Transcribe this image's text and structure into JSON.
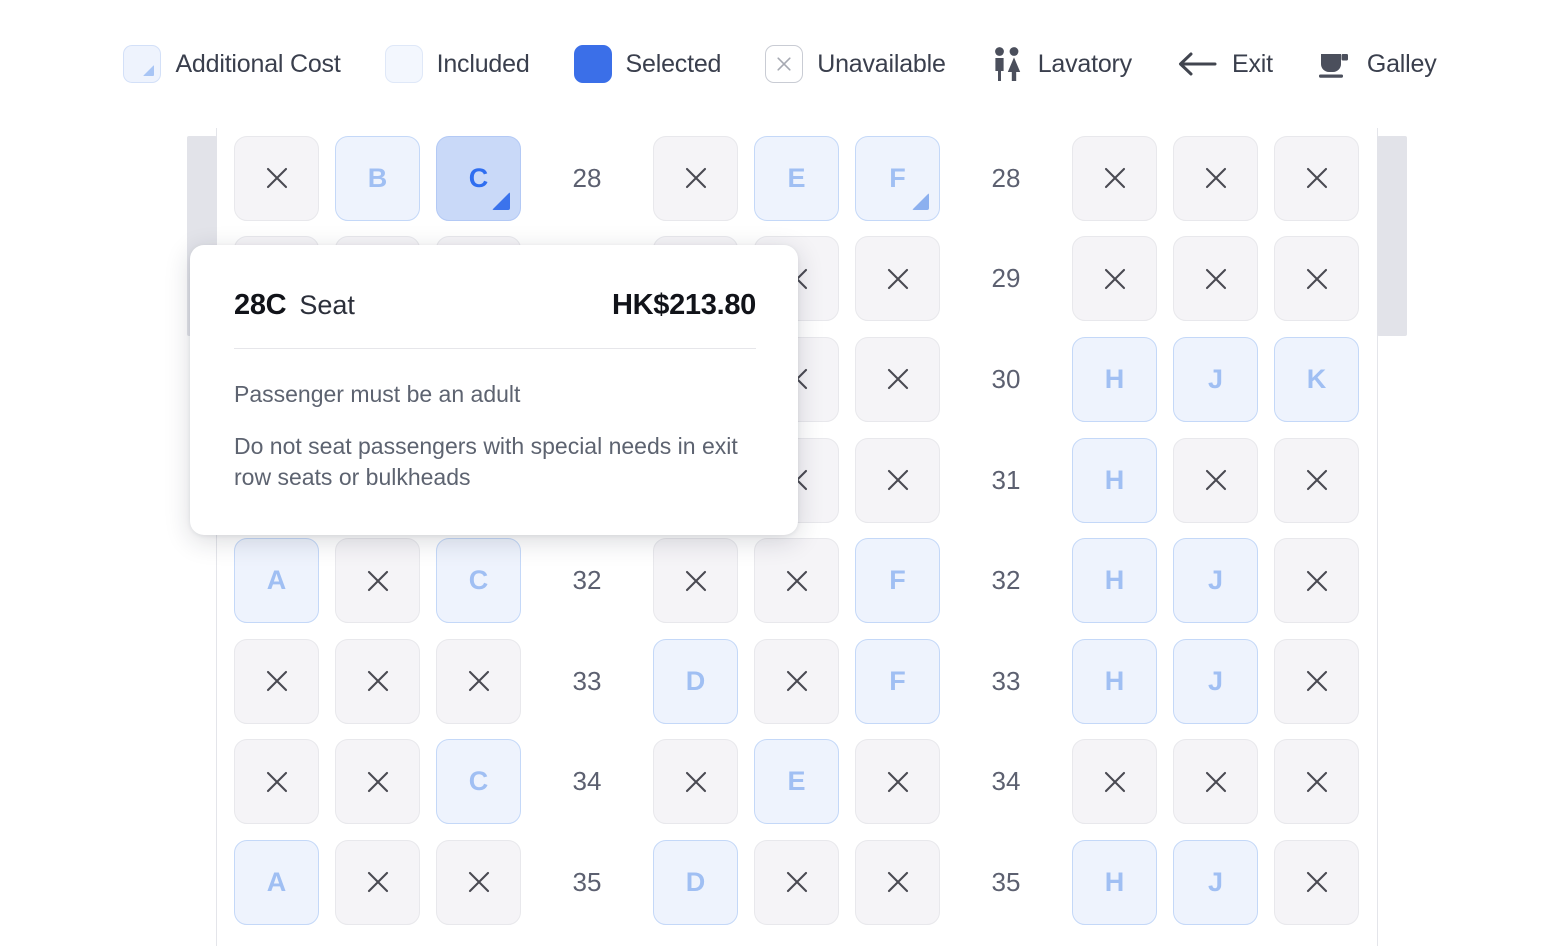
{
  "legend": {
    "items": [
      {
        "label": "Additional Cost",
        "icon": "additional-cost-swatch-icon"
      },
      {
        "label": "Included",
        "icon": "included-swatch-icon"
      },
      {
        "label": "Selected",
        "icon": "selected-swatch-icon"
      },
      {
        "label": "Unavailable",
        "icon": "unavailable-swatch-icon"
      },
      {
        "label": "Lavatory",
        "icon": "lavatory-icon"
      },
      {
        "label": "Exit",
        "icon": "exit-arrow-icon"
      },
      {
        "label": "Galley",
        "icon": "galley-cup-icon"
      }
    ]
  },
  "colors": {
    "selected": "#3b6fe8",
    "included_bg": "#eef3fd",
    "included_text": "#a0bff3",
    "unavailable_bg": "#f5f4f7",
    "hovered_bg": "#c9d9f8",
    "hovered_text": "#2f6ef0",
    "wall": "#e2e3e9",
    "text": "#3a3f4d"
  },
  "tooltip": {
    "seat_number": "28C",
    "seat_word": "Seat",
    "price": "HK$213.80",
    "notes": [
      "Passenger must be an adult",
      "Do not seat passengers with special needs in exit row seats or bulkheads"
    ]
  },
  "seatmap": {
    "unavailable_glyph": "×",
    "rows": [
      {
        "number": "28",
        "left": [
          {
            "label": "×",
            "state": "unavailable"
          },
          {
            "label": "B",
            "state": "included"
          },
          {
            "label": "C",
            "state": "hovered",
            "addcost": true
          }
        ],
        "middle": [
          {
            "label": "×",
            "state": "unavailable"
          },
          {
            "label": "E",
            "state": "included"
          },
          {
            "label": "F",
            "state": "addcost",
            "addcost": true
          }
        ],
        "right": [
          {
            "label": "×",
            "state": "unavailable"
          },
          {
            "label": "×",
            "state": "unavailable"
          },
          {
            "label": "×",
            "state": "unavailable"
          }
        ]
      },
      {
        "number": "29",
        "left": [
          {
            "label": "×",
            "state": "unavailable"
          },
          {
            "label": "×",
            "state": "unavailable"
          },
          {
            "label": "×",
            "state": "unavailable"
          }
        ],
        "middle": [
          {
            "label": "×",
            "state": "unavailable"
          },
          {
            "label": "×",
            "state": "unavailable"
          },
          {
            "label": "×",
            "state": "unavailable"
          }
        ],
        "right": [
          {
            "label": "×",
            "state": "unavailable"
          },
          {
            "label": "×",
            "state": "unavailable"
          },
          {
            "label": "×",
            "state": "unavailable"
          }
        ]
      },
      {
        "number": "30",
        "left": [
          {
            "label": "×",
            "state": "unavailable"
          },
          {
            "label": "×",
            "state": "unavailable"
          },
          {
            "label": "×",
            "state": "unavailable"
          }
        ],
        "middle": [
          {
            "label": "×",
            "state": "unavailable"
          },
          {
            "label": "×",
            "state": "unavailable"
          },
          {
            "label": "×",
            "state": "unavailable"
          }
        ],
        "right": [
          {
            "label": "H",
            "state": "included"
          },
          {
            "label": "J",
            "state": "included"
          },
          {
            "label": "K",
            "state": "included"
          }
        ]
      },
      {
        "number": "31",
        "left": [
          {
            "label": "×",
            "state": "unavailable"
          },
          {
            "label": "×",
            "state": "unavailable"
          },
          {
            "label": "×",
            "state": "unavailable"
          }
        ],
        "middle": [
          {
            "label": "×",
            "state": "unavailable"
          },
          {
            "label": "×",
            "state": "unavailable"
          },
          {
            "label": "×",
            "state": "unavailable"
          }
        ],
        "right": [
          {
            "label": "H",
            "state": "included"
          },
          {
            "label": "×",
            "state": "unavailable"
          },
          {
            "label": "×",
            "state": "unavailable"
          }
        ]
      },
      {
        "number": "32",
        "left": [
          {
            "label": "A",
            "state": "included"
          },
          {
            "label": "×",
            "state": "unavailable"
          },
          {
            "label": "C",
            "state": "included"
          }
        ],
        "middle": [
          {
            "label": "×",
            "state": "unavailable"
          },
          {
            "label": "×",
            "state": "unavailable"
          },
          {
            "label": "F",
            "state": "included"
          }
        ],
        "right": [
          {
            "label": "H",
            "state": "included"
          },
          {
            "label": "J",
            "state": "included"
          },
          {
            "label": "×",
            "state": "unavailable"
          }
        ]
      },
      {
        "number": "33",
        "left": [
          {
            "label": "×",
            "state": "unavailable"
          },
          {
            "label": "×",
            "state": "unavailable"
          },
          {
            "label": "×",
            "state": "unavailable"
          }
        ],
        "middle": [
          {
            "label": "D",
            "state": "included"
          },
          {
            "label": "×",
            "state": "unavailable"
          },
          {
            "label": "F",
            "state": "included"
          }
        ],
        "right": [
          {
            "label": "H",
            "state": "included"
          },
          {
            "label": "J",
            "state": "included"
          },
          {
            "label": "×",
            "state": "unavailable"
          }
        ]
      },
      {
        "number": "34",
        "left": [
          {
            "label": "×",
            "state": "unavailable"
          },
          {
            "label": "×",
            "state": "unavailable"
          },
          {
            "label": "C",
            "state": "included"
          }
        ],
        "middle": [
          {
            "label": "×",
            "state": "unavailable"
          },
          {
            "label": "E",
            "state": "included"
          },
          {
            "label": "×",
            "state": "unavailable"
          }
        ],
        "right": [
          {
            "label": "×",
            "state": "unavailable"
          },
          {
            "label": "×",
            "state": "unavailable"
          },
          {
            "label": "×",
            "state": "unavailable"
          }
        ]
      },
      {
        "number": "35",
        "left": [
          {
            "label": "A",
            "state": "included"
          },
          {
            "label": "×",
            "state": "unavailable"
          },
          {
            "label": "×",
            "state": "unavailable"
          }
        ],
        "middle": [
          {
            "label": "D",
            "state": "included"
          },
          {
            "label": "×",
            "state": "unavailable"
          },
          {
            "label": "×",
            "state": "unavailable"
          }
        ],
        "right": [
          {
            "label": "H",
            "state": "included"
          },
          {
            "label": "J",
            "state": "included"
          },
          {
            "label": "×",
            "state": "unavailable"
          }
        ]
      }
    ]
  }
}
